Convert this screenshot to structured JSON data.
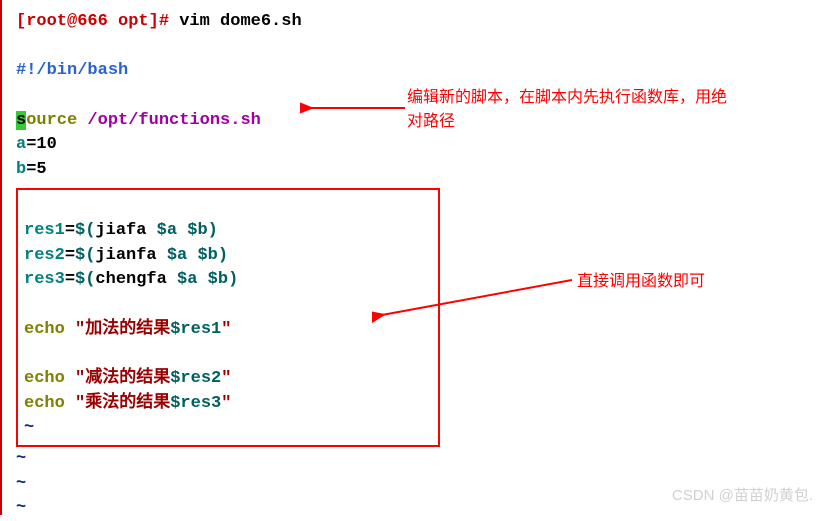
{
  "prompt": {
    "userhost": "[root@666 opt]#",
    "command": "vim dome6.sh"
  },
  "script": {
    "shebang": "#!/bin/bash",
    "source_char": "s",
    "source_rest": "ource",
    "source_path": "/opt/functions.sh",
    "var_a_name": "a",
    "var_a_eq_val": "=10",
    "var_b_name": "b",
    "var_b_eq_val": "=5",
    "res1_name": "res1",
    "res2_name": "res2",
    "res3_name": "res3",
    "eq": "=",
    "sub_open": "$(",
    "sub_close": ")",
    "fn_jiafa": "jiafa ",
    "fn_jianfa": "jianfa ",
    "fn_chengfa": "chengfa ",
    "vars_ab": "$a $b",
    "echo_kw": "echo ",
    "quote": "\"",
    "echo1_text": "加法的结果",
    "echo2_text": "减法的结果",
    "echo3_text": "乘法的结果",
    "ref_res1": "$res1",
    "ref_res2": "$res2",
    "ref_res3": "$res3",
    "tilde": "~"
  },
  "annotations": {
    "annot1_line1": "编辑新的脚本，在脚本内先执行函数库，用绝",
    "annot1_line2": "对路径",
    "annot2": "直接调用函数即可"
  },
  "watermark": "CSDN @苗苗奶黄包."
}
